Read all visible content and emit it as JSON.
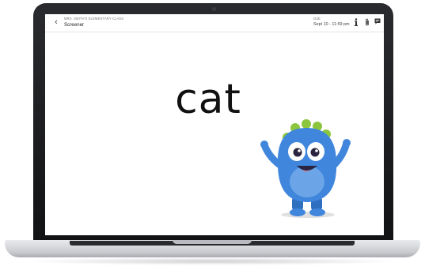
{
  "header": {
    "back_icon": "chevron-left-icon",
    "class_name": "MRS. SMITH'S ELEMENTARY CLASS",
    "assignment_title": "Screener",
    "due_label": "DUE",
    "due_date": "Sept 10 - 11:59 pm",
    "icons": [
      "info-icon",
      "paperclip-icon",
      "comment-icon"
    ]
  },
  "content": {
    "word": "cat"
  },
  "colors": {
    "monster_body": "#3f86dc",
    "monster_belly": "#8fc0f2",
    "monster_spikes": "#8cc63f"
  }
}
